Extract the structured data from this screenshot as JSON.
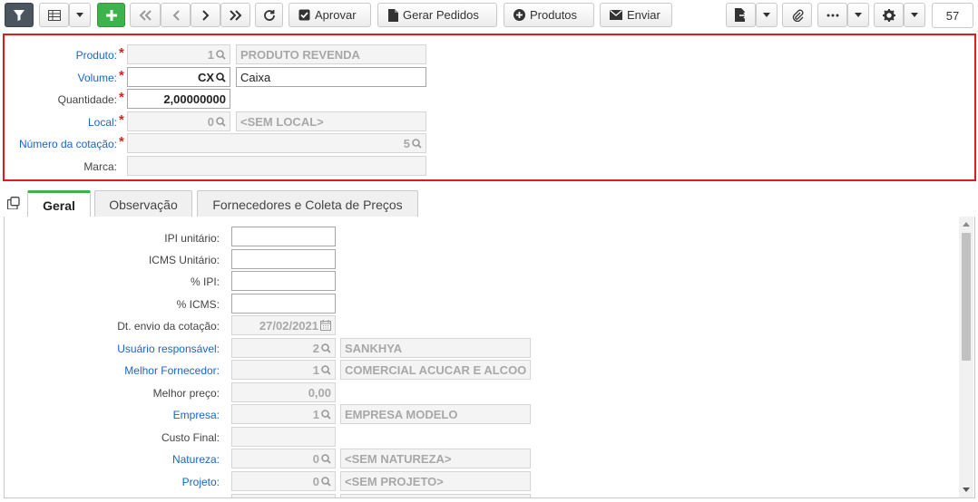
{
  "toolbar": {
    "approve_label": "Aprovar",
    "generate_orders_label": "Gerar Pedidos",
    "products_label": "Produtos",
    "send_label": "Enviar",
    "record_count": "57"
  },
  "header": {
    "produto": {
      "label": "Produto:",
      "code": "1",
      "description": "PRODUTO REVENDA"
    },
    "volume": {
      "label": "Volume:",
      "code": "CX",
      "description": "Caixa"
    },
    "quantidade": {
      "label": "Quantidade:",
      "value": "2,00000000"
    },
    "local": {
      "label": "Local:",
      "code": "0",
      "description": "<SEM LOCAL>"
    },
    "numero_cotacao": {
      "label": "Número da cotação:",
      "value": "5"
    },
    "marca": {
      "label": "Marca:",
      "value": ""
    }
  },
  "tabs": [
    {
      "label": "Geral"
    },
    {
      "label": "Observação"
    },
    {
      "label": "Fornecedores e Coleta de Preços"
    }
  ],
  "geral": {
    "ipi_unitario": {
      "label": "IPI unitário:",
      "value": ""
    },
    "icms_unitario": {
      "label": "ICMS Unitário:",
      "value": ""
    },
    "pct_ipi": {
      "label": "% IPI:",
      "value": ""
    },
    "pct_icms": {
      "label": "% ICMS:",
      "value": ""
    },
    "dt_envio": {
      "label": "Dt. envio da cotação:",
      "value": "27/02/2021"
    },
    "usuario": {
      "label": "Usuário responsável:",
      "code": "2",
      "description": "SANKHYA"
    },
    "melhor_fornecedor": {
      "label": "Melhor Fornecedor:",
      "code": "1",
      "description": "COMERCIAL ACUCAR E ALCOO"
    },
    "melhor_preco": {
      "label": "Melhor preço:",
      "value": "0,00"
    },
    "empresa": {
      "label": "Empresa:",
      "code": "1",
      "description": "EMPRESA MODELO"
    },
    "custo_final": {
      "label": "Custo Final:",
      "value": ""
    },
    "natureza": {
      "label": "Natureza:",
      "code": "0",
      "description": "<SEM NATUREZA>"
    },
    "projeto": {
      "label": "Projeto:",
      "code": "0",
      "description": "<SEM PROJETO>"
    }
  },
  "colors": {
    "required": "#d32222",
    "link_label": "#1a64c8",
    "highlight_border": "#e01b1b",
    "active_tab": "#3cb44b"
  }
}
